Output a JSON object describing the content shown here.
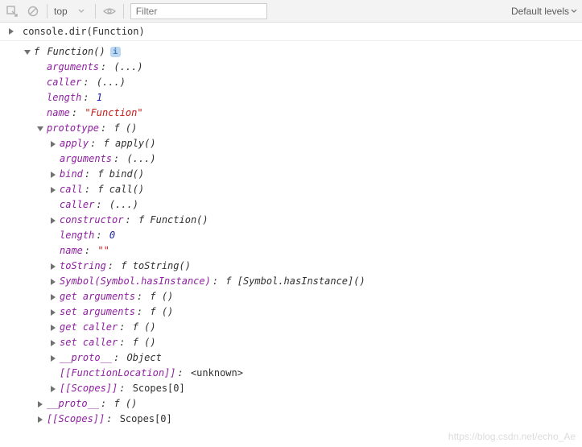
{
  "toolbar": {
    "context": "top",
    "filter_placeholder": "Filter",
    "levels_label": "Default levels"
  },
  "console": {
    "input": "console.dir(Function)"
  },
  "root": {
    "header_prefix": "f ",
    "header_name": "Function()",
    "info_glyph": "i"
  },
  "lvl2": {
    "arguments_k": "arguments",
    "arguments_v": "(...)",
    "caller_k": "caller",
    "caller_v": "(...)",
    "length_k": "length",
    "length_v": "1",
    "name_k": "name",
    "name_v": "\"Function\"",
    "prototype_k": "prototype",
    "prototype_v": "f ()",
    "proto_k": "__proto__",
    "proto_v": "f ()",
    "scopes_k": "[[Scopes]]",
    "scopes_v": "Scopes[0]"
  },
  "lvl3": {
    "apply_k": "apply",
    "apply_v": "f apply()",
    "arguments_k": "arguments",
    "arguments_v": "(...)",
    "bind_k": "bind",
    "bind_v": "f bind()",
    "call_k": "call",
    "call_v": "f call()",
    "caller_k": "caller",
    "caller_v": "(...)",
    "constructor_k": "constructor",
    "constructor_v": "f Function()",
    "length_k": "length",
    "length_v": "0",
    "name_k": "name",
    "name_v": "\"\"",
    "tostring_k": "toString",
    "tostring_v": "f toString()",
    "symbol_k": "Symbol(Symbol.hasInstance)",
    "symbol_v": "f [Symbol.hasInstance]()",
    "getargs_k": "get arguments",
    "getargs_v": "f ()",
    "setargs_k": "set arguments",
    "setargs_v": "f ()",
    "getcaller_k": "get caller",
    "getcaller_v": "f ()",
    "setcaller_k": "set caller",
    "setcaller_v": "f ()",
    "proto_k": "__proto__",
    "proto_v": "Object",
    "funcloc_k": "[[FunctionLocation]]",
    "funcloc_v": "<unknown>",
    "scopes_k": "[[Scopes]]",
    "scopes_v": "Scopes[0]"
  },
  "watermark": "https://blog.csdn.net/echo_Ae"
}
